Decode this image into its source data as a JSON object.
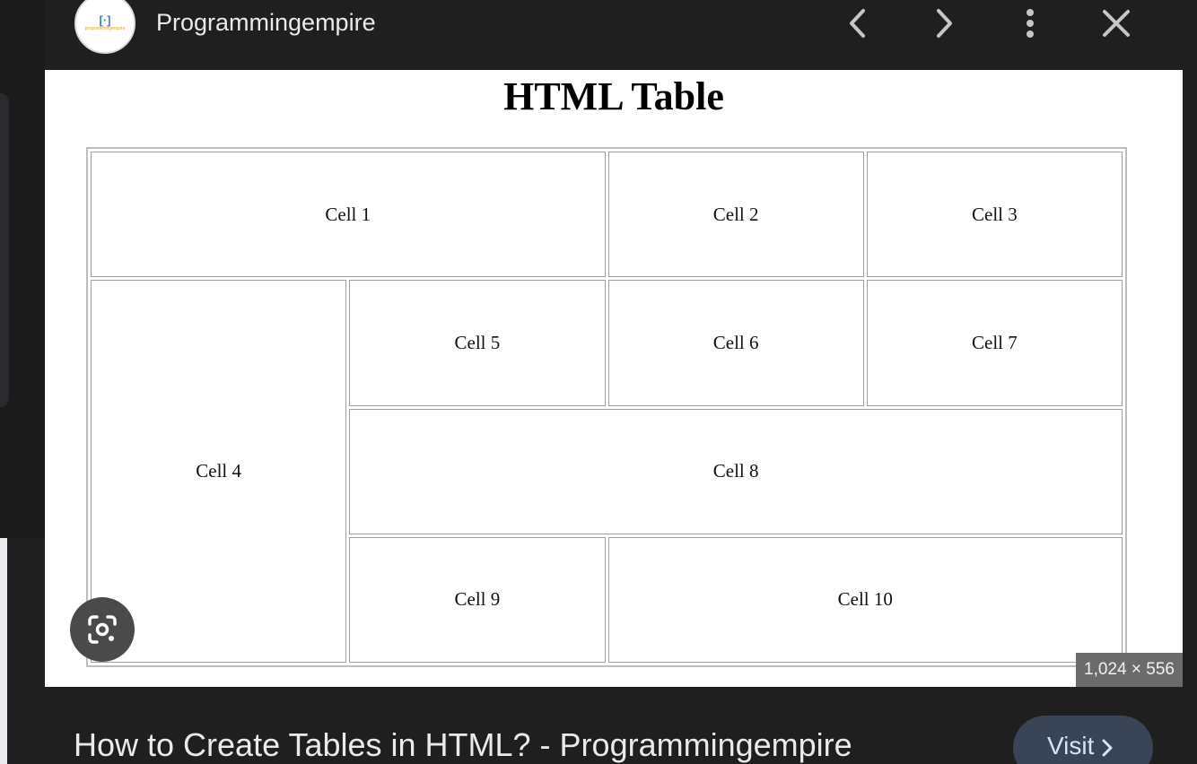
{
  "header": {
    "site_name": "Programmingempire",
    "logo_mark": "[·]",
    "logo_text": "programmingempire"
  },
  "image": {
    "title": "HTML Table",
    "cells": {
      "c1": "Cell 1",
      "c2": "Cell 2",
      "c3": "Cell 3",
      "c4": "Cell 4",
      "c5": "Cell 5",
      "c6": "Cell 6",
      "c7": "Cell 7",
      "c8": "Cell 8",
      "c9": "Cell 9",
      "c10": "Cell 10"
    },
    "dimensions": "1,024 × 556"
  },
  "footer": {
    "caption": "How to Create Tables in HTML? - Programmingempire",
    "visit_label": "Visit"
  },
  "icons": {
    "prev": "chevron-left-icon",
    "next": "chevron-right-icon",
    "more": "more-vert-icon",
    "close": "close-icon",
    "lens": "lens-icon"
  },
  "colors": {
    "background": "#1f1f1f",
    "visit_button": "#394457",
    "visit_text": "#d2e3fc"
  }
}
